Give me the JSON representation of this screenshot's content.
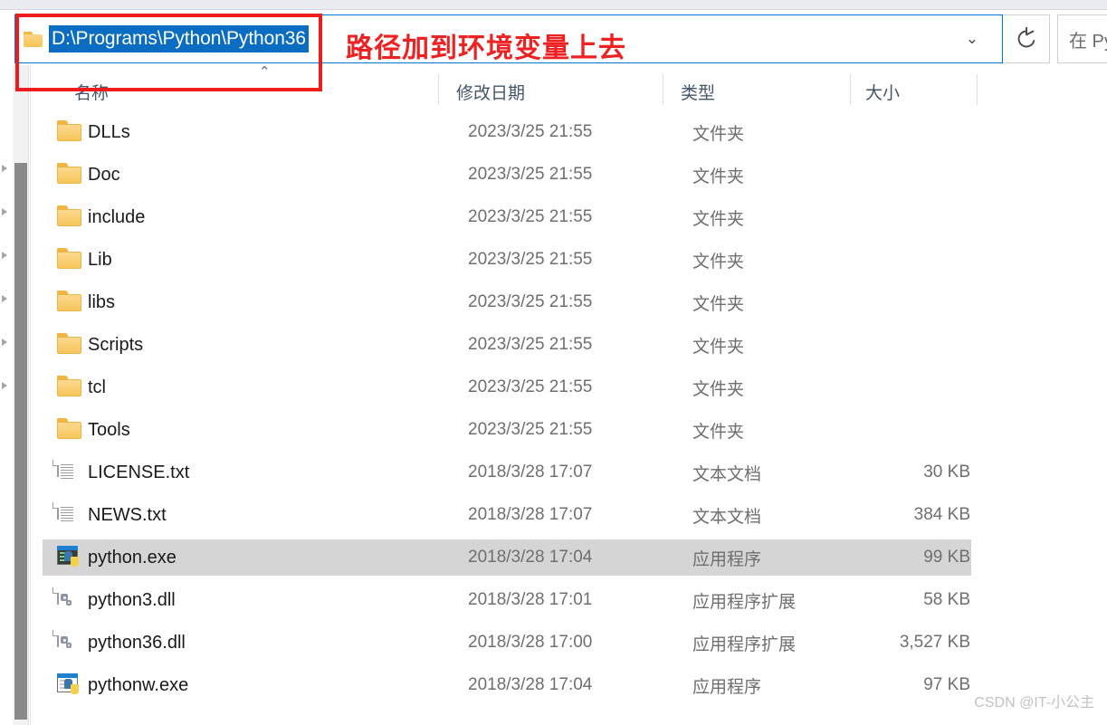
{
  "window": {
    "address_bar": {
      "path": "D:\\Programs\\Python\\Python36",
      "folder_icon": "folder-icon",
      "dropdown_icon": "chevron-down-icon",
      "refresh_icon": "refresh-icon"
    },
    "search": {
      "placeholder": "在 Py",
      "icon": "search-icon"
    }
  },
  "columns": {
    "name": "名称",
    "date_modified": "修改日期",
    "type": "类型",
    "size": "大小",
    "sort_caret": "⌃"
  },
  "files": [
    {
      "name": "DLLs",
      "icon": "folder-icon",
      "date": "2023/3/25 21:55",
      "type": "文件夹",
      "size": "",
      "selected": false
    },
    {
      "name": "Doc",
      "icon": "folder-icon",
      "date": "2023/3/25 21:55",
      "type": "文件夹",
      "size": "",
      "selected": false
    },
    {
      "name": "include",
      "icon": "folder-icon",
      "date": "2023/3/25 21:55",
      "type": "文件夹",
      "size": "",
      "selected": false
    },
    {
      "name": "Lib",
      "icon": "folder-icon",
      "date": "2023/3/25 21:55",
      "type": "文件夹",
      "size": "",
      "selected": false
    },
    {
      "name": "libs",
      "icon": "folder-icon",
      "date": "2023/3/25 21:55",
      "type": "文件夹",
      "size": "",
      "selected": false
    },
    {
      "name": "Scripts",
      "icon": "folder-icon",
      "date": "2023/3/25 21:55",
      "type": "文件夹",
      "size": "",
      "selected": false
    },
    {
      "name": "tcl",
      "icon": "folder-icon",
      "date": "2023/3/25 21:55",
      "type": "文件夹",
      "size": "",
      "selected": false
    },
    {
      "name": "Tools",
      "icon": "folder-icon",
      "date": "2023/3/25 21:55",
      "type": "文件夹",
      "size": "",
      "selected": false
    },
    {
      "name": "LICENSE.txt",
      "icon": "text-file-icon",
      "date": "2018/3/28 17:07",
      "type": "文本文档",
      "size": "30 KB",
      "selected": false
    },
    {
      "name": "NEWS.txt",
      "icon": "text-file-icon",
      "date": "2018/3/28 17:07",
      "type": "文本文档",
      "size": "384 KB",
      "selected": false
    },
    {
      "name": "python.exe",
      "icon": "python-exe-icon",
      "date": "2018/3/28 17:04",
      "type": "应用程序",
      "size": "99 KB",
      "selected": true
    },
    {
      "name": "python3.dll",
      "icon": "dll-file-icon",
      "date": "2018/3/28 17:01",
      "type": "应用程序扩展",
      "size": "58 KB",
      "selected": false
    },
    {
      "name": "python36.dll",
      "icon": "dll-file-icon",
      "date": "2018/3/28 17:00",
      "type": "应用程序扩展",
      "size": "3,527 KB",
      "selected": false
    },
    {
      "name": "pythonw.exe",
      "icon": "pythonw-exe-icon",
      "date": "2018/3/28 17:04",
      "type": "应用程序",
      "size": "97 KB",
      "selected": false
    }
  ],
  "annotation": {
    "text": "路径加到环境变量上去",
    "color": "#ee2222"
  },
  "watermark": "CSDN @IT-小公主",
  "colors": {
    "selection_blue": "#0a6dc2",
    "focus_border": "#0078d7",
    "row_selected": "#d5d5d5",
    "header_text": "#44546a",
    "annotation_red": "#ee1c1c"
  }
}
